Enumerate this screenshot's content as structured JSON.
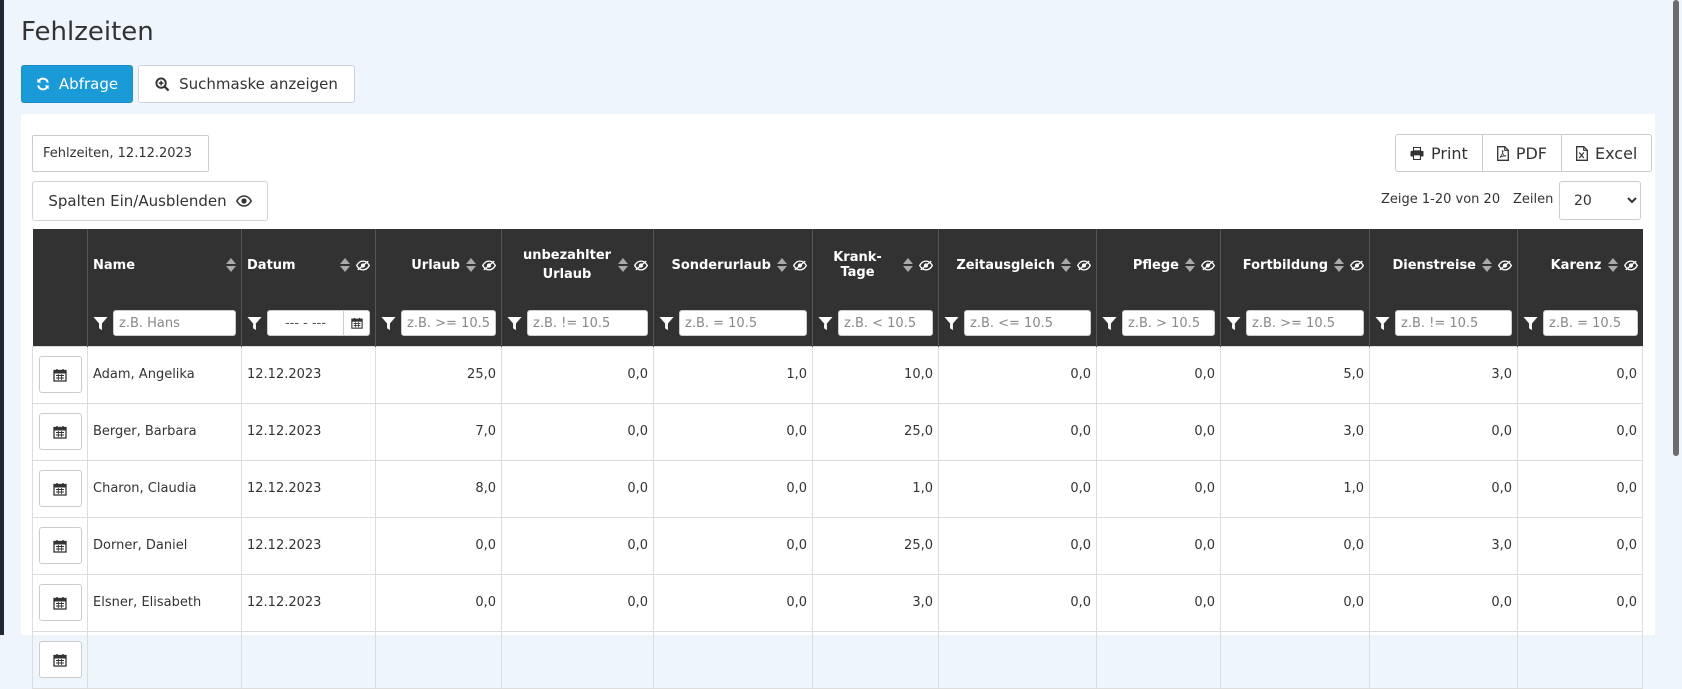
{
  "page": {
    "title": "Fehlzeiten"
  },
  "toolbar": {
    "query_label": "Abfrage",
    "search_mask_label": "Suchmaske anzeigen"
  },
  "report": {
    "title_value": "Fehlzeiten, 12.12.2023",
    "toggle_columns_label": "Spalten Ein/Ausblenden"
  },
  "export": {
    "print_label": "Print",
    "pdf_label": "PDF",
    "excel_label": "Excel"
  },
  "pagination": {
    "info": "Zeige 1-20 von 20",
    "rows_label": "Zeilen",
    "rows_value": "20"
  },
  "columns": [
    {
      "label": "Name",
      "filter_placeholder": "z.B. Hans"
    },
    {
      "label": "Datum",
      "filter_placeholder": "--- - ---"
    },
    {
      "label": "Urlaub",
      "filter_placeholder": "z.B. >= 10.5"
    },
    {
      "label": "unbezahlter Urlaub",
      "filter_placeholder": "z.B. != 10.5"
    },
    {
      "label": "Sonderurlaub",
      "filter_placeholder": "z.B. = 10.5"
    },
    {
      "label": "Krank-Tage",
      "filter_placeholder": "z.B. < 10.5"
    },
    {
      "label": "Zeitausgleich",
      "filter_placeholder": "z.B. <= 10.5"
    },
    {
      "label": "Pflege",
      "filter_placeholder": "z.B. > 10.5"
    },
    {
      "label": "Fortbildung",
      "filter_placeholder": "z.B. >= 10.5"
    },
    {
      "label": "Dienstreise",
      "filter_placeholder": "z.B. != 10.5"
    },
    {
      "label": "Karenz",
      "filter_placeholder": "z.B. = 10.5"
    }
  ],
  "rows": [
    {
      "name": "Adam, Angelika",
      "date": "12.12.2023",
      "values": [
        "25,0",
        "0,0",
        "1,0",
        "10,0",
        "0,0",
        "0,0",
        "5,0",
        "3,0",
        "0,0"
      ]
    },
    {
      "name": "Berger, Barbara",
      "date": "12.12.2023",
      "values": [
        "7,0",
        "0,0",
        "0,0",
        "25,0",
        "0,0",
        "0,0",
        "3,0",
        "0,0",
        "0,0"
      ]
    },
    {
      "name": "Charon, Claudia",
      "date": "12.12.2023",
      "values": [
        "8,0",
        "0,0",
        "0,0",
        "1,0",
        "0,0",
        "0,0",
        "1,0",
        "0,0",
        "0,0"
      ]
    },
    {
      "name": "Dorner, Daniel",
      "date": "12.12.2023",
      "values": [
        "0,0",
        "0,0",
        "0,0",
        "25,0",
        "0,0",
        "0,0",
        "0,0",
        "3,0",
        "0,0"
      ]
    },
    {
      "name": "Elsner, Elisabeth",
      "date": "12.12.2023",
      "values": [
        "0,0",
        "0,0",
        "0,0",
        "3,0",
        "0,0",
        "0,0",
        "0,0",
        "0,0",
        "0,0"
      ]
    },
    {
      "name": "",
      "date": "",
      "values": [
        "",
        "",
        "",
        "",
        "",
        "",
        "",
        "",
        ""
      ]
    }
  ],
  "colors": {
    "primary": "#1a9bd7",
    "header_bg": "#323232",
    "page_bg": "#eef5fd"
  }
}
